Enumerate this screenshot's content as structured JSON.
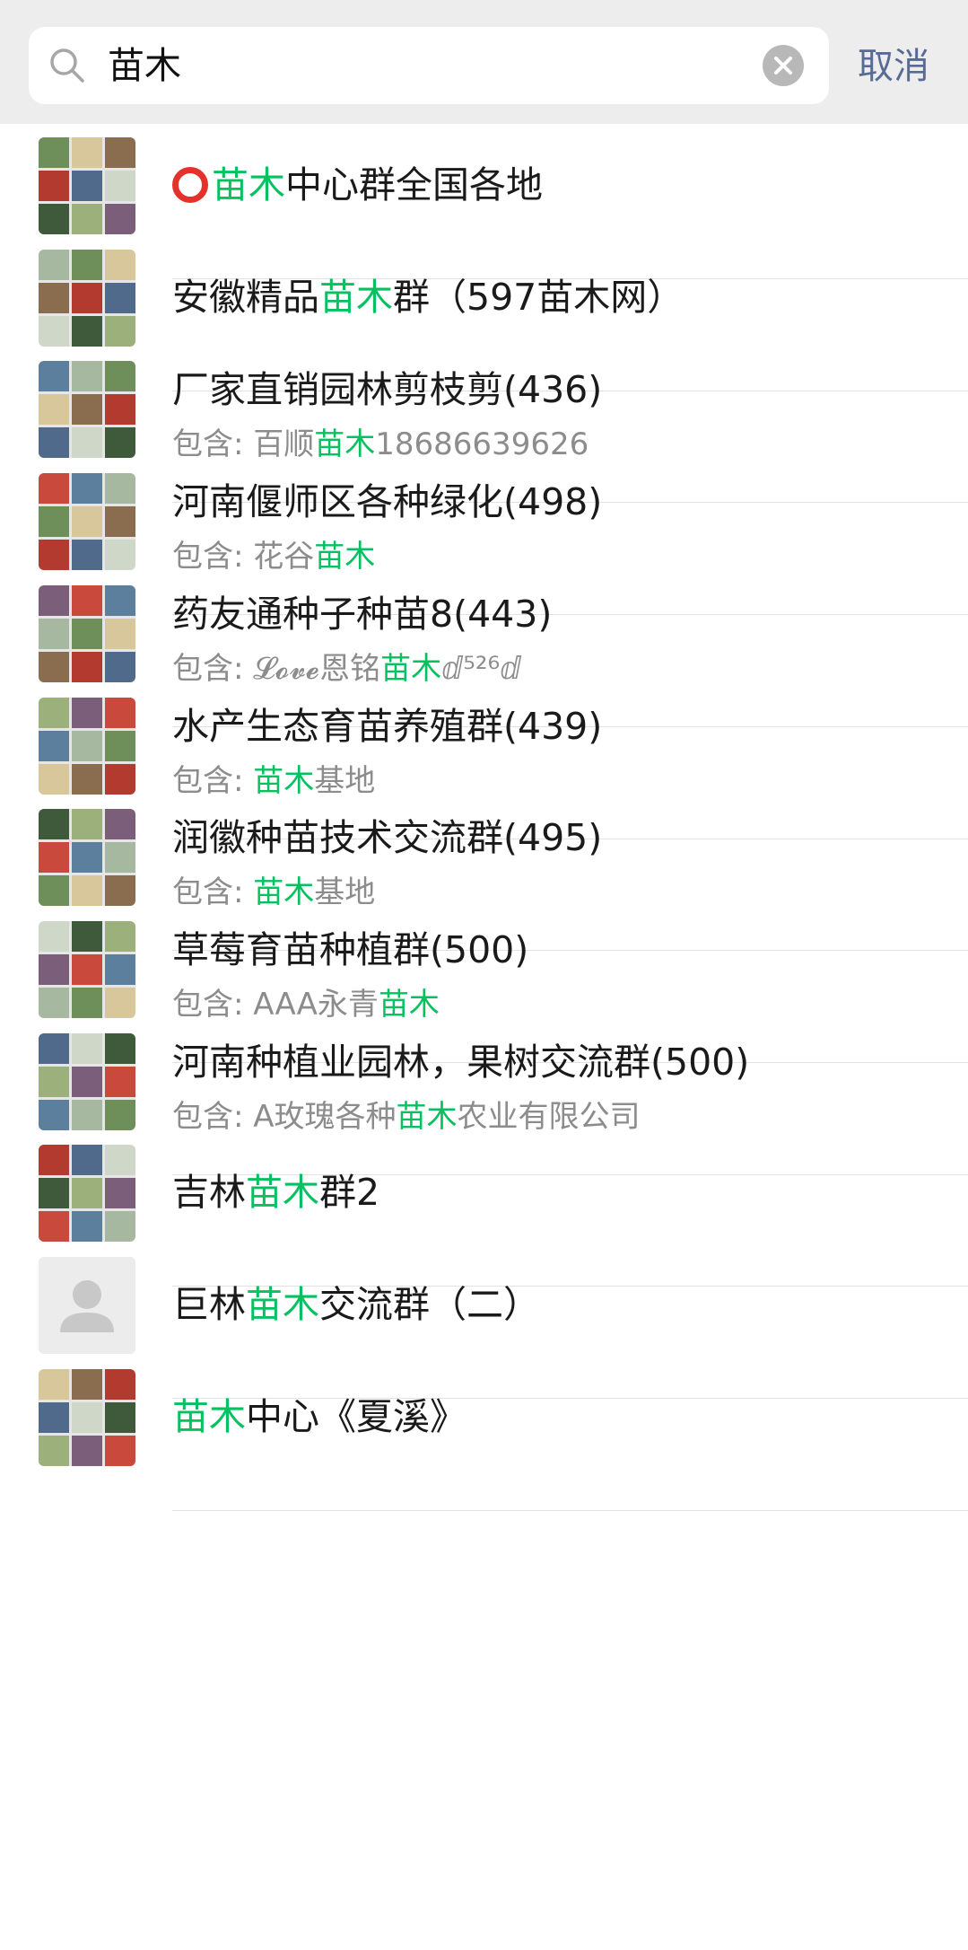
{
  "search": {
    "value": "苗木",
    "cancel_label": "取消"
  },
  "results": [
    {
      "pre": "",
      "hl": "苗木",
      "post": "中心群全国各地",
      "sub_pre": "",
      "sub_hl": "",
      "sub_post": "",
      "ring": true
    },
    {
      "pre": "安徽精品",
      "hl": "苗木",
      "post": "群（597苗木网）",
      "sub_pre": "",
      "sub_hl": "",
      "sub_post": ""
    },
    {
      "pre": "厂家直销园林剪枝剪(436)",
      "hl": "",
      "post": "",
      "sub_pre": "包含: 百顺",
      "sub_hl": "苗木",
      "sub_post": "18686639626"
    },
    {
      "pre": "河南偃师区各种绿化(498)",
      "hl": "",
      "post": "",
      "sub_pre": "包含: 花谷",
      "sub_hl": "苗木",
      "sub_post": ""
    },
    {
      "pre": "药友通种子种苗8(443)",
      "hl": "",
      "post": "",
      "sub_pre": "包含: 𝓛𝓸𝓿𝓮恩铭",
      "sub_hl": "苗木",
      "sub_post": "ⅆ⁵²⁶ⅆ"
    },
    {
      "pre": "水产生态育苗养殖群(439)",
      "hl": "",
      "post": "",
      "sub_pre": "包含: ",
      "sub_hl": "苗木",
      "sub_post": "基地"
    },
    {
      "pre": "润徽种苗技术交流群(495)",
      "hl": "",
      "post": "",
      "sub_pre": "包含: ",
      "sub_hl": "苗木",
      "sub_post": "基地"
    },
    {
      "pre": "草莓育苗种植群(500)",
      "hl": "",
      "post": "",
      "sub_pre": "包含: AAA永青",
      "sub_hl": "苗木",
      "sub_post": ""
    },
    {
      "pre": "河南种植业园林，果树交流群(500)",
      "hl": "",
      "post": "",
      "sub_pre": "包含: A玫瑰各种",
      "sub_hl": "苗木",
      "sub_post": "农业有限公司"
    },
    {
      "pre": "吉林",
      "hl": "苗木",
      "post": "群2",
      "sub_pre": "",
      "sub_hl": "",
      "sub_post": ""
    },
    {
      "pre": "巨林",
      "hl": "苗木",
      "post": "交流群（二）",
      "sub_pre": "",
      "sub_hl": "",
      "sub_post": "",
      "default_avatar": true
    },
    {
      "pre": "",
      "hl": "苗木",
      "post": "中心《夏溪》",
      "sub_pre": "",
      "sub_hl": "",
      "sub_post": ""
    }
  ],
  "colors": {
    "highlight": "#07c160",
    "cancel": "#576b95",
    "ring": "#e4312b"
  }
}
